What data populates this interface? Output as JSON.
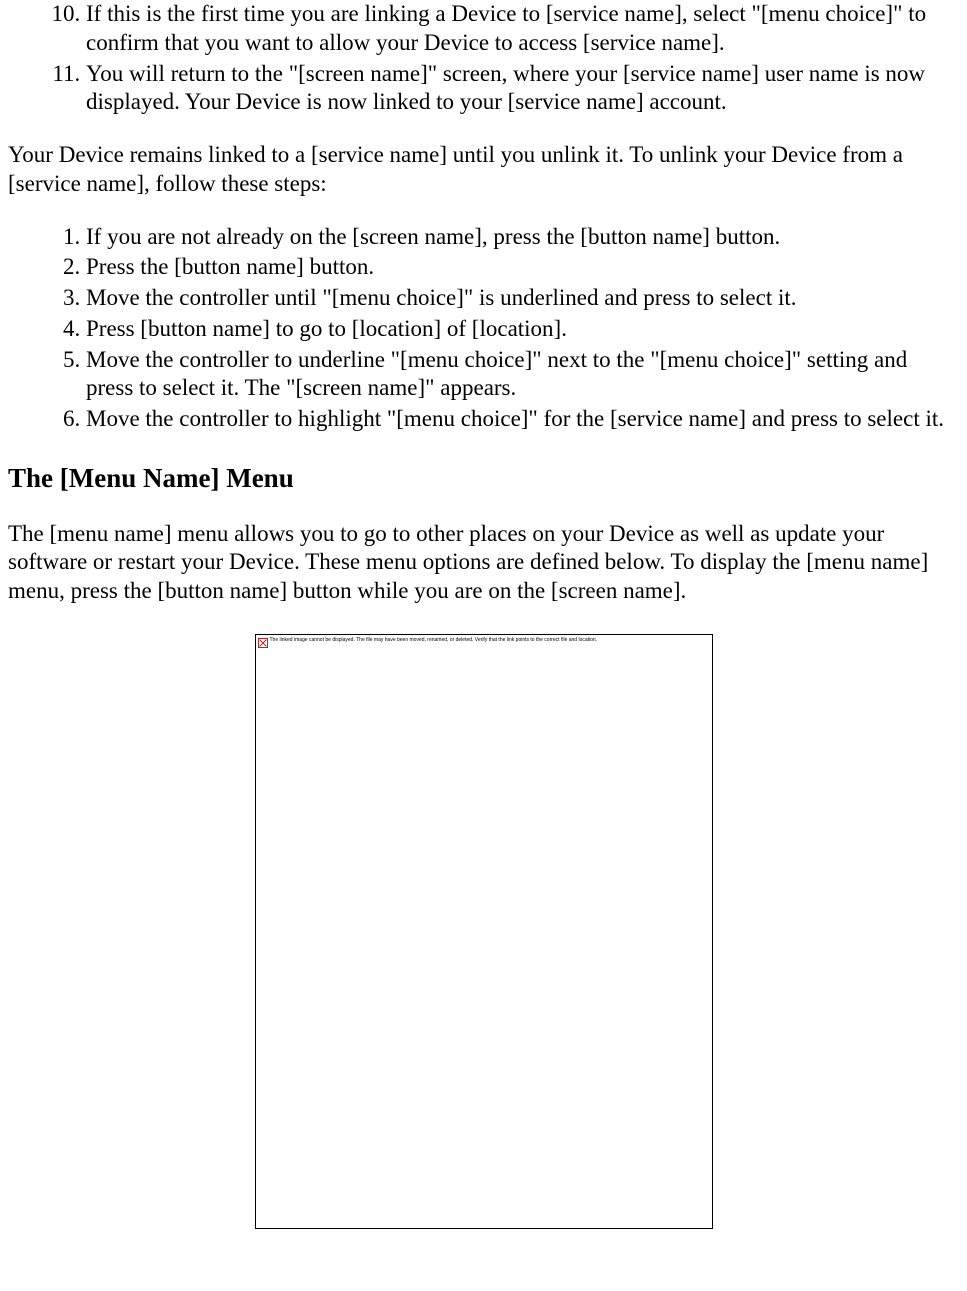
{
  "list1": {
    "start": 10,
    "items": [
      "If this is the first time you are linking a Device to [service name], select \"[menu choice]\" to confirm that you want to allow your Device to access [service name].",
      "You will return to the \"[screen name]\" screen, where your [service name] user name is now displayed. Your Device is now linked to your [service name] account."
    ]
  },
  "para1": "Your Device remains linked to a [service name] until you unlink it. To unlink your Device from a [service name], follow these steps:",
  "list2": {
    "start": 1,
    "items": [
      "If you are not already on the [screen name], press the [button name] button.",
      "Press the [button name] button.",
      "Move the controller until \"[menu choice]\" is underlined and press to select it.",
      "Press [button name] to go to [location] of [location].",
      "Move the controller to underline \"[menu choice]\" next to the \"[menu choice]\" setting and press to select it. The \"[screen name]\" appears.",
      "Move the controller to highlight \"[menu choice]\" for the [service name] and press to select it."
    ]
  },
  "heading": "The [Menu Name] Menu",
  "para2": "The [menu name] menu allows you to go to other places on your Device as well as update your software or restart your Device. These menu options are defined below. To display the [menu name] menu, press the [button name] button while you are on the [screen name].",
  "brokenImageText": "The linked image cannot be displayed. The file may have been moved, renamed, or deleted. Verify that the link points to the correct file and location."
}
